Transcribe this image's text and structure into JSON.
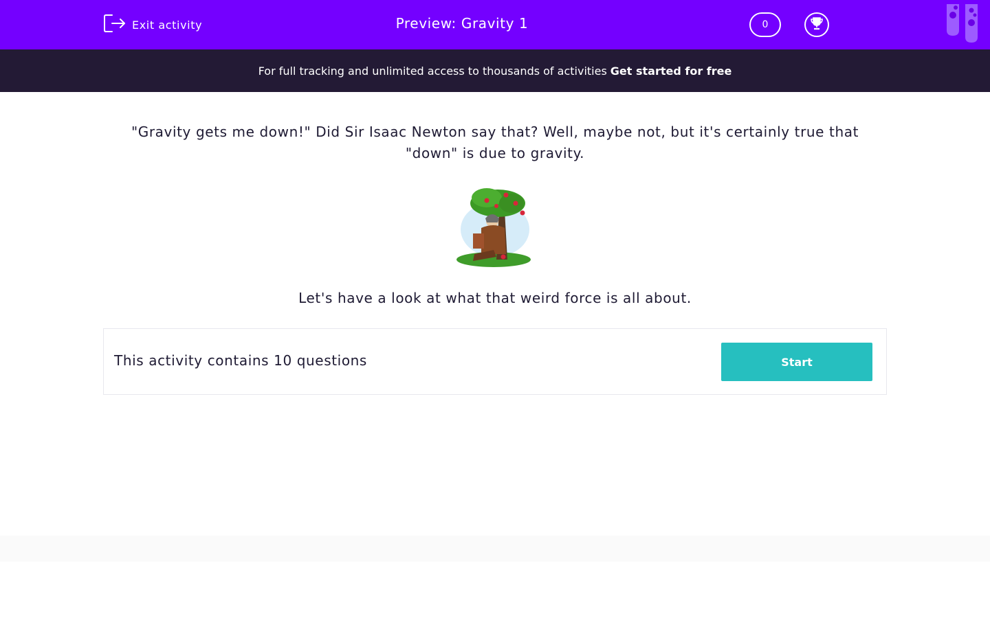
{
  "header": {
    "exit_label": "Exit activity",
    "title": "Preview: Gravity 1",
    "score": "0",
    "exit_icon": "exit-arrow-icon",
    "trophy_icon": "trophy-icon"
  },
  "promo": {
    "text": "For full tracking and unlimited access to thousands of activities",
    "link": "Get started for free"
  },
  "intro": {
    "text": "\"Gravity gets me down!\"  Did Sir Isaac Newton say that?  Well, maybe not, but it's certainly true that \"down\" is due to gravity.",
    "image_icon": "newton-under-apple-tree-illustration",
    "subtext": "Let's have a look at what that weird force is all about."
  },
  "activity": {
    "info": "This activity contains 10 questions",
    "start_label": "Start"
  },
  "colors": {
    "header_bg": "#7400ff",
    "promo_bg": "#231a35",
    "start_button": "#26bfbf",
    "text": "#1e1a33"
  }
}
